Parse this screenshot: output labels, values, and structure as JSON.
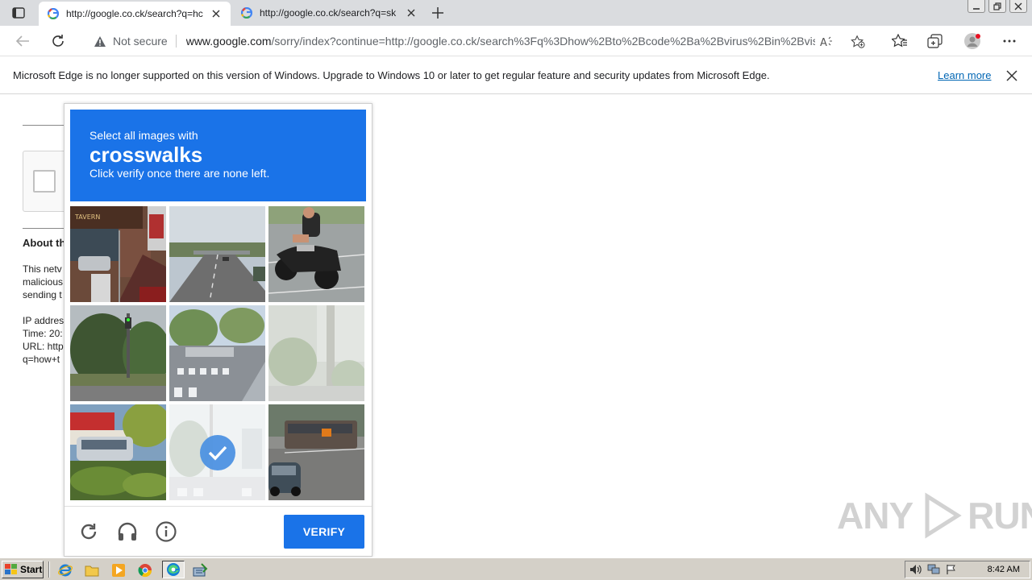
{
  "browser": {
    "tabs": [
      {
        "title": "http://google.co.ck/search?q=hc",
        "active": true
      },
      {
        "title": "http://google.co.ck/search?q=sk",
        "active": false
      }
    ],
    "address": {
      "security_label": "Not secure",
      "host": "www.google.com",
      "path": "/sorry/index?continue=http://google.co.ck/search%3Fq%3Dhow%2Bto%2Bcode%2Ba%2Bvirus%2Bin%2Bvisu..."
    }
  },
  "infobar": {
    "message": "Microsoft Edge is no longer supported on this version of Windows. Upgrade to Windows 10 or later to get regular feature and security updates from Microsoft Edge.",
    "link": "Learn more"
  },
  "background_page": {
    "heading": "About th",
    "lines": [
      "This netv",
      "malicious",
      "sending t"
    ],
    "details": [
      "IP addres",
      "Time: 20:",
      "URL: http",
      "q=how+t"
    ]
  },
  "captcha": {
    "instruction": "Select all images with",
    "target": "crosswalks",
    "sub_instruction": "Click verify once there are none left.",
    "verify_label": "VERIFY",
    "tiles": [
      {
        "id": 1,
        "selected": false
      },
      {
        "id": 2,
        "selected": false
      },
      {
        "id": 3,
        "selected": false
      },
      {
        "id": 4,
        "selected": false
      },
      {
        "id": 5,
        "selected": false
      },
      {
        "id": 6,
        "selected": false
      },
      {
        "id": 7,
        "selected": false
      },
      {
        "id": 8,
        "selected": true
      },
      {
        "id": 9,
        "selected": false
      }
    ],
    "accent_color": "#1a73e8"
  },
  "watermark": {
    "left": "ANY",
    "right": "RUN"
  },
  "taskbar": {
    "start_label": "Start",
    "clock": "8:42 AM"
  }
}
